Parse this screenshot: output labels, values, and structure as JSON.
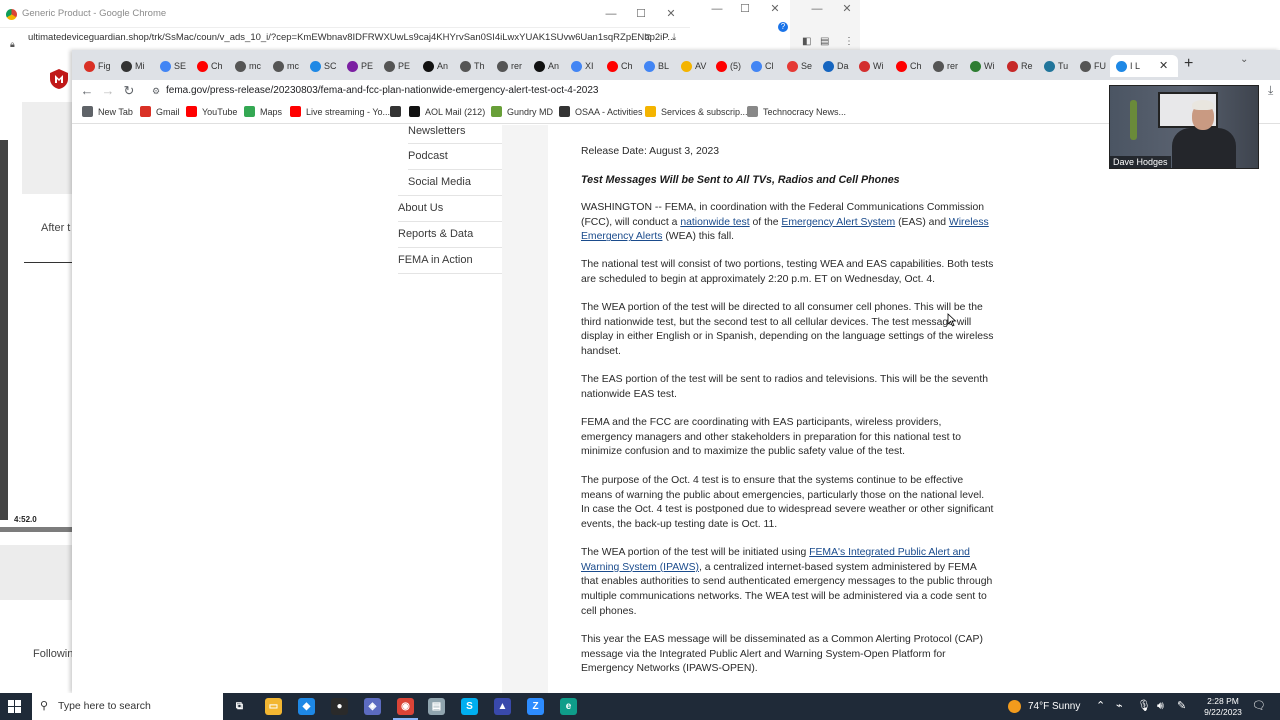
{
  "background_window": {
    "title": "Generic Product - Google Chrome",
    "url": "ultimatedeviceguardian.shop/trk/SsMac/coun/v_ads_10_i/?cep=KmEWbnav8IDFRWXUwLs9caj4KHYrvSan0SI4iLwxYUAK1SUvw6Uan1sqRZpENbp2iP...",
    "side_text_1": "After t",
    "side_time": "4:52.0",
    "side_text_2": "Followin"
  },
  "tabs": [
    {
      "label": "Fig",
      "color": "#d93025"
    },
    {
      "label": "Mi",
      "color": "#333333"
    },
    {
      "label": "SE",
      "color": "#4285f4"
    },
    {
      "label": "Ch",
      "color": "#ff0000"
    },
    {
      "label": "mc",
      "color": "#555555"
    },
    {
      "label": "mc",
      "color": "#555555"
    },
    {
      "label": "SC",
      "color": "#1e88e5"
    },
    {
      "label": "PE",
      "color": "#7b1fa2"
    },
    {
      "label": "PE",
      "color": "#555555"
    },
    {
      "label": "An",
      "color": "#111111"
    },
    {
      "label": "Th",
      "color": "#555555"
    },
    {
      "label": "rer",
      "color": "#555555"
    },
    {
      "label": "An",
      "color": "#111111"
    },
    {
      "label": "XI",
      "color": "#4285f4"
    },
    {
      "label": "Ch",
      "color": "#ff0000"
    },
    {
      "label": "BL",
      "color": "#4285f4"
    },
    {
      "label": "AV",
      "color": "#f4b400"
    },
    {
      "label": "(5)",
      "color": "#ff0000"
    },
    {
      "label": "Cl",
      "color": "#4285f4"
    },
    {
      "label": "Se",
      "color": "#e53935"
    },
    {
      "label": "Da",
      "color": "#1565c0"
    },
    {
      "label": "Wi",
      "color": "#d32f2f"
    },
    {
      "label": "Ch",
      "color": "#ff0000"
    },
    {
      "label": "rer",
      "color": "#555555"
    },
    {
      "label": "Wi",
      "color": "#2e7d32"
    },
    {
      "label": "Re",
      "color": "#c62828"
    },
    {
      "label": "Tu",
      "color": "#21759b"
    },
    {
      "label": "FU",
      "color": "#555555"
    },
    {
      "label": "I L",
      "color": "#1e88e5"
    }
  ],
  "address": "fema.gov/press-release/20230803/fema-and-fcc-plan-nationwide-emergency-alert-test-oct-4-2023",
  "bookmarks": [
    {
      "label": "New Tab",
      "color": "#5f6368"
    },
    {
      "label": "Gmail",
      "color": "#d93025"
    },
    {
      "label": "YouTube",
      "color": "#ff0000"
    },
    {
      "label": "Maps",
      "color": "#34a853"
    },
    {
      "label": "Live streaming - Yo...",
      "color": "#ff0000"
    },
    {
      "label": "",
      "color": "#333333"
    },
    {
      "label": "AOL Mail (212)",
      "color": "#111111"
    },
    {
      "label": "Gundry MD",
      "color": "#689f38"
    },
    {
      "label": "OSAA - Activities",
      "color": "#333333"
    },
    {
      "label": "Services & subscrip...",
      "color": "#f4b400"
    },
    {
      "label": "Technocracy News...",
      "color": "#888888"
    }
  ],
  "side_nav": {
    "sub_items": [
      "Newsletters",
      "Podcast",
      "Social Media"
    ],
    "main_items": [
      "About Us",
      "Reports & Data",
      "FEMA in Action"
    ]
  },
  "article": {
    "release_date": "Release Date: August 3, 2023",
    "headline": "Test Messages Will be Sent to All TVs, Radios and Cell Phones",
    "p1_a": "WASHINGTON -- FEMA, in coordination with the Federal Communications Commission (FCC), will conduct a ",
    "p1_link1": "nationwide test",
    "p1_b": " of the ",
    "p1_link2": "Emergency Alert System",
    "p1_c": " (EAS) and ",
    "p1_link3": "Wireless Emergency Alerts",
    "p1_d": " (WEA) this fall.",
    "p2": "The national test will consist of two portions, testing WEA and EAS capabilities. Both tests are scheduled to begin at approximately 2:20 p.m. ET on Wednesday, Oct. 4.",
    "p3": "The WEA portion of the test will be directed to all consumer cell phones. This will be the third nationwide test, but the second test to all cellular devices. The test message will display in either English or in Spanish, depending on the language settings of the wireless handset.",
    "p4": "The EAS portion of the test will be sent to radios and televisions. This will be the seventh nationwide EAS test.",
    "p5": "FEMA and the FCC are coordinating with EAS participants, wireless providers, emergency managers and other stakeholders in preparation for this national test to minimize confusion and to maximize the public safety value of the test.",
    "p6": "The purpose of the Oct. 4 test is to ensure that the systems continue to be effective means of warning the public about emergencies, particularly those on the national level. In case the Oct. 4 test is postponed due to widespread severe weather or other significant events, the back-up testing date is Oct. 11.",
    "p7_a": "The WEA portion of the test will be initiated using ",
    "p7_link": "FEMA's Integrated Public Alert and Warning System (IPAWS)",
    "p7_b": ", a centralized internet-based system administered by FEMA that enables authorities to send authenticated emergency messages to the public through multiple communications networks. The WEA test will be administered via a code sent to cell phones.",
    "p8": "This year the EAS message will be disseminated as a Common Alerting Protocol (CAP) message via the Integrated Public Alert and Warning System-Open Platform for Emergency Networks (IPAWS-OPEN)."
  },
  "webcam": {
    "name": "Dave Hodges"
  },
  "taskbar": {
    "search_placeholder": "Type here to search",
    "weather": "74°F  Sunny",
    "time": "2:28 PM",
    "date": "9/22/2023",
    "apps": [
      {
        "name": "task-view",
        "color": "#1f2a38",
        "glyph": "⧉"
      },
      {
        "name": "file-explorer",
        "color": "#f2b632",
        "glyph": "▭"
      },
      {
        "name": "app-blue",
        "color": "#1e88e5",
        "glyph": "◆"
      },
      {
        "name": "app-camera",
        "color": "#2a2a2a",
        "glyph": "●"
      },
      {
        "name": "app-purple",
        "color": "#5c6bc0",
        "glyph": "◈"
      },
      {
        "name": "chrome",
        "color": "#db4437",
        "glyph": "◉"
      },
      {
        "name": "app-notes",
        "color": "#90a4ae",
        "glyph": "▤"
      },
      {
        "name": "skype",
        "color": "#00aff0",
        "glyph": "S"
      },
      {
        "name": "app-vlc",
        "color": "#3949ab",
        "glyph": "▲"
      },
      {
        "name": "zoom",
        "color": "#2d8cff",
        "glyph": "Z"
      },
      {
        "name": "edge",
        "color": "#0f9d8a",
        "glyph": "e"
      }
    ]
  }
}
